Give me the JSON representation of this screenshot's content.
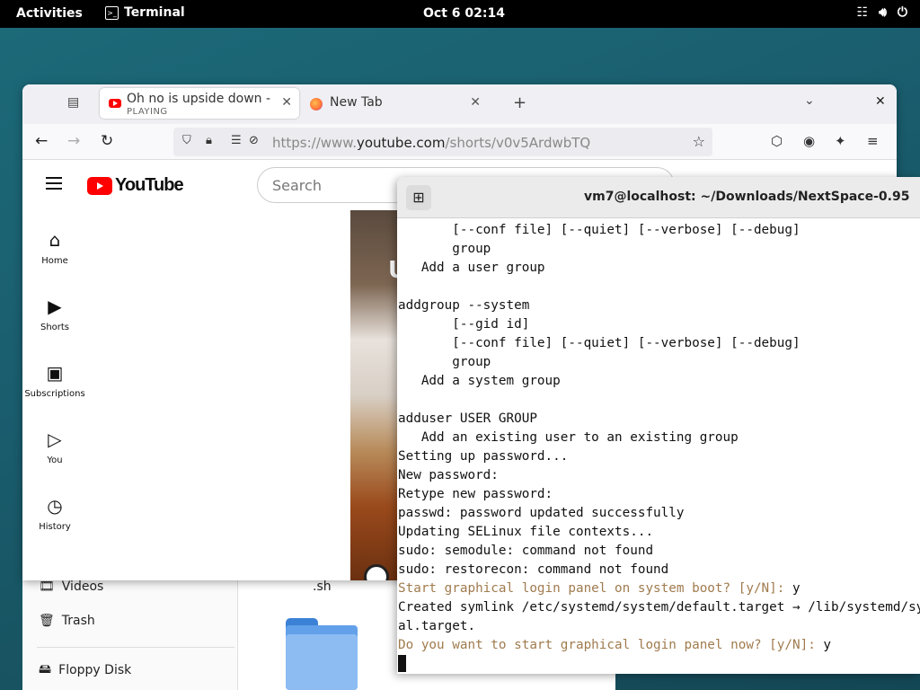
{
  "topbar": {
    "activities": "Activities",
    "app_name": "Terminal",
    "clock": "Oct 6  02:14",
    "status_icons": [
      "network-icon",
      "volume-icon",
      "power-icon"
    ]
  },
  "files": {
    "sidebar": [
      {
        "label": "Videos",
        "icon": "video-icon"
      },
      {
        "label": "Trash",
        "icon": "trash-icon"
      },
      {
        "label": "Floppy Disk",
        "icon": "drive-icon"
      }
    ],
    "file_label": ".sh"
  },
  "firefox": {
    "tabs": [
      {
        "title": "Oh no is upside down - YouTube",
        "subtitle": "PLAYING",
        "active": true
      },
      {
        "title": "New Tab",
        "subtitle": "",
        "active": false
      }
    ],
    "url_prefix": "https://www.",
    "url_domain": "youtube.com",
    "url_path": "/shorts/v0v5ArdwbTQ"
  },
  "youtube": {
    "logo_text": "YouTube",
    "search_placeholder": "Search",
    "nav": [
      {
        "label": "Home",
        "icon": "home-icon"
      },
      {
        "label": "Shorts",
        "icon": "shorts-icon"
      },
      {
        "label": "Subscriptions",
        "icon": "subscriptions-icon"
      },
      {
        "label": "You",
        "icon": "you-icon"
      },
      {
        "label": "History",
        "icon": "history-icon"
      }
    ],
    "video_overlay_text": "U"
  },
  "terminal": {
    "title": "vm7@localhost: ~/Downloads/NextSpace-0.95",
    "lines": [
      {
        "text": "       [--conf file] [--quiet] [--verbose] [--debug]",
        "prompt": false
      },
      {
        "text": "       group",
        "prompt": false
      },
      {
        "text": "   Add a user group",
        "prompt": false
      },
      {
        "text": "",
        "prompt": false
      },
      {
        "text": "addgroup --system",
        "prompt": false
      },
      {
        "text": "       [--gid id]",
        "prompt": false
      },
      {
        "text": "       [--conf file] [--quiet] [--verbose] [--debug]",
        "prompt": false
      },
      {
        "text": "       group",
        "prompt": false
      },
      {
        "text": "   Add a system group",
        "prompt": false
      },
      {
        "text": "",
        "prompt": false
      },
      {
        "text": "adduser USER GROUP",
        "prompt": false
      },
      {
        "text": "   Add an existing user to an existing group",
        "prompt": false
      },
      {
        "text": "Setting up password...",
        "prompt": false
      },
      {
        "text": "New password:",
        "prompt": false
      },
      {
        "text": "Retype new password:",
        "prompt": false
      },
      {
        "text": "passwd: password updated successfully",
        "prompt": false
      },
      {
        "text": "Updating SELinux file contexts...",
        "prompt": false
      },
      {
        "text": "sudo: semodule: command not found",
        "prompt": false
      },
      {
        "text": "sudo: restorecon: command not found",
        "prompt": false
      },
      {
        "text": "Start graphical login panel on system boot? [y/N]:",
        "answer": " y",
        "prompt": true
      },
      {
        "text": "Created symlink /etc/systemd/system/default.target → /lib/systemd/system/graphic",
        "prompt": false
      },
      {
        "text": "al.target.",
        "prompt": false
      },
      {
        "text": "Do you want to start graphical login panel now? [y/N]:",
        "answer": " y",
        "prompt": true
      }
    ]
  }
}
